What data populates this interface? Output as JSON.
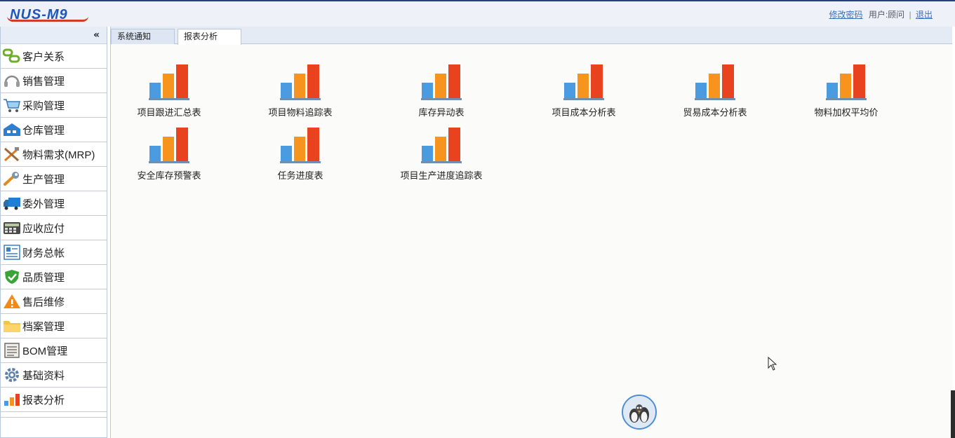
{
  "header": {
    "logo_text": "NUS-M9",
    "change_password": "修改密码",
    "user_label": "用户:顾问",
    "separator": "|",
    "logout": "退出"
  },
  "sidebar": {
    "collapse_icon": "«",
    "items": [
      {
        "label": "客户关系",
        "icon": "customer-chain-icon"
      },
      {
        "label": "销售管理",
        "icon": "headset-icon"
      },
      {
        "label": "采购管理",
        "icon": "shopping-cart-icon"
      },
      {
        "label": "仓库管理",
        "icon": "warehouse-icon"
      },
      {
        "label": "物料需求(MRP)",
        "icon": "tools-icon"
      },
      {
        "label": "生产管理",
        "icon": "wrench-icon"
      },
      {
        "label": "委外管理",
        "icon": "truck-icon"
      },
      {
        "label": "应收应付",
        "icon": "calculator-icon"
      },
      {
        "label": "财务总帐",
        "icon": "ledger-icon"
      },
      {
        "label": "品质管理",
        "icon": "shield-check-icon"
      },
      {
        "label": "售后维修",
        "icon": "warning-icon"
      },
      {
        "label": "档案管理",
        "icon": "folder-icon"
      },
      {
        "label": "BOM管理",
        "icon": "document-icon"
      },
      {
        "label": "基础资料",
        "icon": "gear-icon"
      },
      {
        "label": "报表分析",
        "icon": "bar-chart-icon"
      }
    ]
  },
  "tabs": [
    {
      "label": "系统通知"
    },
    {
      "label": "报表分析"
    }
  ],
  "reports": [
    {
      "label": "项目跟进汇总表"
    },
    {
      "label": "项目物料追踪表"
    },
    {
      "label": "库存异动表"
    },
    {
      "label": "项目成本分析表"
    },
    {
      "label": "贸易成本分析表"
    },
    {
      "label": "物料加权平均价"
    },
    {
      "label": "安全库存预警表"
    },
    {
      "label": "任务进度表"
    },
    {
      "label": "项目生产进度追踪表"
    }
  ],
  "colors": {
    "bar_blue": "#4a9be0",
    "bar_orange": "#f7941d",
    "bar_red": "#e8431e",
    "link": "#3a6fc0"
  }
}
